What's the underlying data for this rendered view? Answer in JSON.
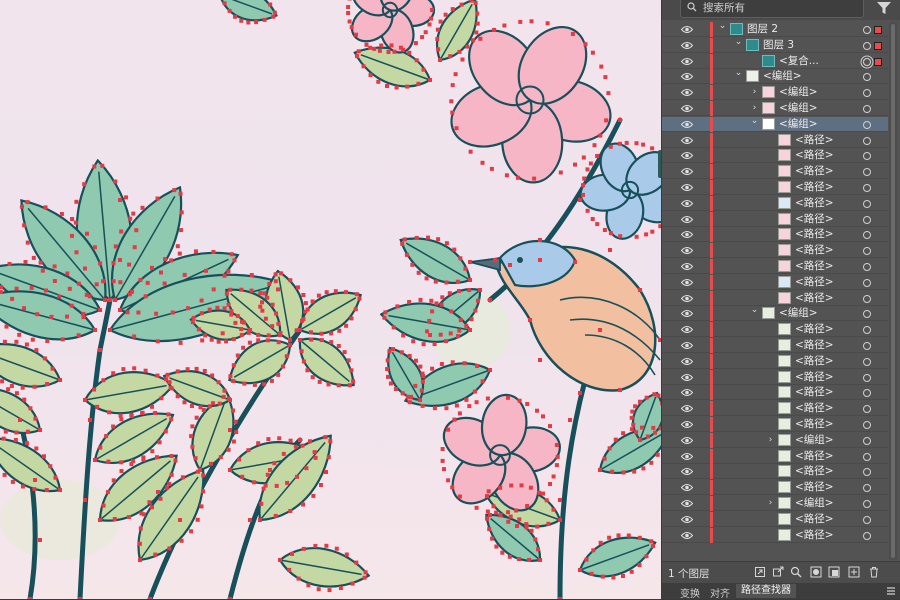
{
  "panel": {
    "search_placeholder": "搜索所有",
    "filter_icon": "filter-funnel-icon",
    "layer_count": "1 个图层",
    "footer_tools": [
      "collect-for-export-icon",
      "locate-object-icon",
      "search-icon",
      "make-clipping-mask-icon",
      "new-sublayer-icon",
      "new-layer-icon",
      "trash-icon"
    ],
    "tabs": [
      "变换",
      "对齐",
      "路径查找器"
    ],
    "active_tab": "路径查找器",
    "selection_color": "#e74b4b",
    "rows": [
      {
        "name": "图层 2",
        "expanded": true,
        "thumb": "teal",
        "target": "target",
        "selected": true
      },
      {
        "name": "图层 3",
        "expanded": true,
        "thumb": "teal",
        "target": "target",
        "selected": true
      },
      {
        "name": "<复合...",
        "thumb": "teal",
        "target": "double",
        "selected": true
      },
      {
        "name": "<编组>",
        "expanded": true,
        "thumb": "group",
        "target": "target"
      },
      {
        "name": "<编组>",
        "expanded": false,
        "thumb": "pink",
        "target": "target"
      },
      {
        "name": "<编组>",
        "expanded": false,
        "thumb": "pink",
        "target": "target"
      },
      {
        "name": "<编组>",
        "expanded": true,
        "thumb": "white",
        "target": "target",
        "highlighted": true
      },
      {
        "name": "<路径>",
        "thumb": "pink"
      },
      {
        "name": "<路径>",
        "thumb": "pink"
      },
      {
        "name": "<路径>",
        "thumb": "pink"
      },
      {
        "name": "<路径>",
        "thumb": "pink"
      },
      {
        "name": "<路径>",
        "thumb": "blue"
      },
      {
        "name": "<路径>",
        "thumb": "pink"
      },
      {
        "name": "<路径>",
        "thumb": "pink"
      },
      {
        "name": "<路径>",
        "thumb": "pink"
      },
      {
        "name": "<路径>",
        "thumb": "pink"
      },
      {
        "name": "<路径>",
        "thumb": "blue"
      },
      {
        "name": "<路径>",
        "thumb": "pink"
      },
      {
        "name": "<编组>",
        "expanded": true,
        "thumb": "green"
      },
      {
        "name": "<路径>",
        "thumb": "green"
      },
      {
        "name": "<路径>",
        "thumb": "green"
      },
      {
        "name": "<路径>",
        "thumb": "green"
      },
      {
        "name": "<路径>",
        "thumb": "green"
      },
      {
        "name": "<路径>",
        "thumb": "green"
      },
      {
        "name": "<路径>",
        "thumb": "green"
      },
      {
        "name": "<路径>",
        "thumb": "green"
      },
      {
        "name": "<编组>",
        "expanded": false,
        "thumb": "green"
      },
      {
        "name": "<路径>",
        "thumb": "green"
      },
      {
        "name": "<路径>",
        "thumb": "green"
      },
      {
        "name": "<路径>",
        "thumb": "green"
      },
      {
        "name": "<编组>",
        "expanded": false,
        "thumb": "green"
      },
      {
        "name": "<路径>",
        "thumb": "green"
      },
      {
        "name": "<路径>",
        "thumb": "green"
      }
    ]
  },
  "canvas": {
    "artwork": "botanical-illustration-with-bird",
    "colors": {
      "outline": "#17505a",
      "leaf": "#8ec9b0",
      "leaf_light": "#c4d8a4",
      "petal": "#f6b6c5",
      "petal_blue": "#a9cbe9",
      "bird_body": "#f2c0a0",
      "anchor": "#e63946"
    }
  }
}
